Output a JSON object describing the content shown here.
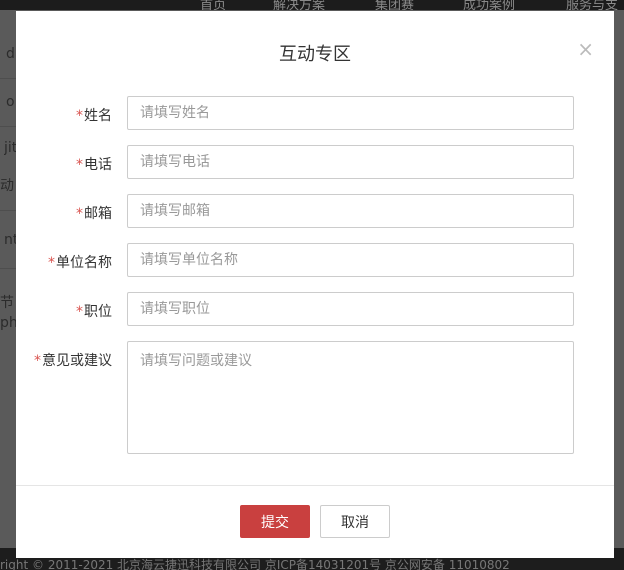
{
  "background": {
    "nav_items": [
      "首页",
      "解决方案",
      "集团赛",
      "成功案例",
      "服务与支"
    ],
    "left_fragments": [
      "d",
      "o",
      "jit",
      "动",
      "nt",
      "节",
      "ph"
    ],
    "footer_text": "right © 2011-2021 北京海云捷迅科技有限公司 京ICP备14031201号 京公网安备 11010802"
  },
  "modal": {
    "title": "互动专区",
    "close_symbol": "×",
    "required_mark": "*",
    "fields": [
      {
        "label": "姓名",
        "placeholder": "请填写姓名"
      },
      {
        "label": "电话",
        "placeholder": "请填写电话"
      },
      {
        "label": "邮箱",
        "placeholder": "请填写邮箱"
      },
      {
        "label": "单位名称",
        "placeholder": "请填写单位名称"
      },
      {
        "label": "职位",
        "placeholder": "请填写职位"
      }
    ],
    "feedback": {
      "label": "意见或建议",
      "placeholder": "请填写问题或建议"
    },
    "submit_label": "提交",
    "cancel_label": "取消"
  },
  "colors": {
    "accent": "#c9403f",
    "required": "#d9534f",
    "overlay": "#5a5a5a"
  }
}
